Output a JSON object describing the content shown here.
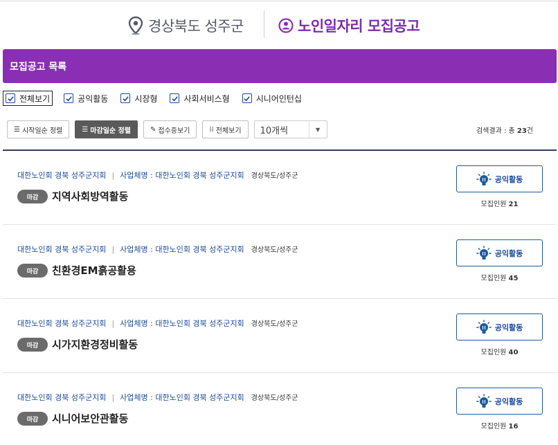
{
  "header": {
    "region": "경상북도 성주군",
    "title": "노인일자리 모집공고"
  },
  "list_bar": {
    "title": "모집공고 목록"
  },
  "filters": [
    {
      "label": "전체보기",
      "checked": true
    },
    {
      "label": "공익활동",
      "checked": true
    },
    {
      "label": "시장형",
      "checked": true
    },
    {
      "label": "사회서비스형",
      "checked": true
    },
    {
      "label": "시니어인턴십",
      "checked": true
    }
  ],
  "controls": {
    "sort_start": "시작일순 정렬",
    "sort_deadline": "마감일순 정렬",
    "view_accepting": "접수중보기",
    "view_all": "전체보기",
    "page_size": "10개씩"
  },
  "result": {
    "prefix": "검색결과 : 총 ",
    "count": "23",
    "suffix": "건"
  },
  "items": [
    {
      "org": "대한노인회 경북 성주군지회",
      "separator": "|",
      "business_label": "사업체명 : 대한노인회 경북 성주군지회",
      "location": "경상북도/성주군",
      "badge": "마감",
      "title": "지역사회방역활동",
      "category": "공익활동",
      "recruit_label": "모집인원 ",
      "recruit_count": "21"
    },
    {
      "org": "대한노인회 경북 성주군지회",
      "separator": "|",
      "business_label": "사업체명 : 대한노인회 경북 성주군지회",
      "location": "경상북도/성주군",
      "badge": "마감",
      "title": "친환경EM흙공활용",
      "category": "공익활동",
      "recruit_label": "모집인원 ",
      "recruit_count": "45"
    },
    {
      "org": "대한노인회 경북 성주군지회",
      "separator": "|",
      "business_label": "사업체명 : 대한노인회 경북 성주군지회",
      "location": "경상북도/성주군",
      "badge": "마감",
      "title": "시가지환경정비활동",
      "category": "공익활동",
      "recruit_label": "모집인원 ",
      "recruit_count": "40"
    },
    {
      "org": "대한노인회 경북 성주군지회",
      "separator": "|",
      "business_label": "사업체명 : 대한노인회 경북 성주군지회",
      "location": "경상북도/성주군",
      "badge": "마감",
      "title": "시니어보안관활동",
      "category": "공익활동",
      "recruit_label": "모집인원 ",
      "recruit_count": "16"
    }
  ],
  "colors": {
    "accent": "#8a2fb3",
    "title": "#7b2cae",
    "link": "#1c4b9c",
    "badge": "#6b6b6b"
  },
  "icons": {
    "region": "location-pin-icon",
    "title": "person-circle-icon",
    "category": "lightbulb-icon",
    "checkbox": "check-icon"
  }
}
